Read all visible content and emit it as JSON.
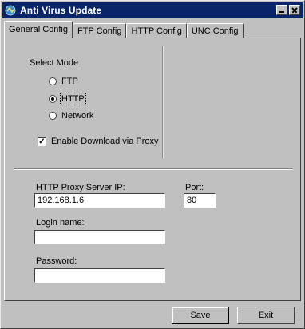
{
  "window": {
    "title": "Anti Virus Update",
    "icon": "antivirus-app-icon"
  },
  "tabs": [
    {
      "label": "General Config",
      "active": true
    },
    {
      "label": "FTP Config",
      "active": false
    },
    {
      "label": "HTTP Config",
      "active": false
    },
    {
      "label": "UNC Config",
      "active": false
    }
  ],
  "mode": {
    "group_label": "Select Mode",
    "options": [
      {
        "label": "FTP",
        "selected": false
      },
      {
        "label": "HTTP",
        "selected": true
      },
      {
        "label": "Network",
        "selected": false
      }
    ]
  },
  "proxy": {
    "enable_label": "Enable Download via Proxy",
    "enabled": true,
    "server_ip_label": "HTTP Proxy Server IP:",
    "server_ip_value": "192.168.1.6",
    "port_label": "Port:",
    "port_value": "80",
    "login_label": "Login name:",
    "login_value": "",
    "password_label": "Password:",
    "password_value": ""
  },
  "buttons": {
    "save": "Save",
    "exit": "Exit"
  }
}
